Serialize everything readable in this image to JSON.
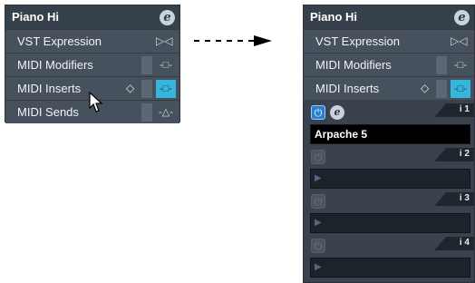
{
  "left": {
    "title": "Piano Hi",
    "rows": [
      {
        "label": "VST Expression"
      },
      {
        "label": "MIDI Modifiers"
      },
      {
        "label": "MIDI Inserts"
      },
      {
        "label": "MIDI Sends"
      }
    ]
  },
  "right": {
    "title": "Piano Hi",
    "rows": [
      {
        "label": "VST Expression"
      },
      {
        "label": "MIDI Modifiers"
      },
      {
        "label": "MIDI Inserts"
      }
    ],
    "slots": [
      {
        "number": "i 1",
        "value": "Arpache 5",
        "active": true
      },
      {
        "number": "i 2",
        "value": "",
        "active": false
      },
      {
        "number": "i 3",
        "value": "",
        "active": false
      },
      {
        "number": "i 4",
        "value": "",
        "active": false
      }
    ]
  },
  "colors": {
    "accent": "#35b7dd",
    "panel": "#3f4954",
    "power_on": "#2a7fd1"
  },
  "icons": [
    "edit-e-icon",
    "vst-expression-icon",
    "toggle-icon",
    "diamond-icon",
    "power-icon",
    "cursor-icon",
    "arrow-icon"
  ]
}
